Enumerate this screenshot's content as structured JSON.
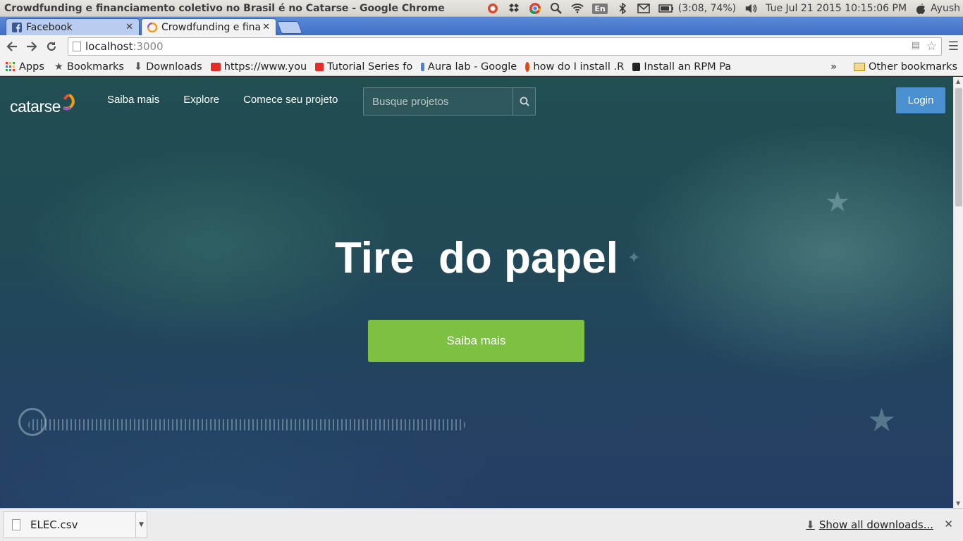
{
  "os": {
    "window_title": "Crowdfunding e financiamento coletivo no Brasil é no Catarse - Google Chrome",
    "keyboard": "En",
    "battery": "(3:08, 74%)",
    "clock": "Tue Jul 21 2015 10:15:06 PM",
    "user": "Ayush"
  },
  "tabs": [
    {
      "label": "Facebook"
    },
    {
      "label": "Crowdfunding e fina"
    }
  ],
  "toolbar": {
    "url_host": "localhost",
    "url_port": ":3000"
  },
  "bookmarks": {
    "items": [
      {
        "label": "Apps"
      },
      {
        "label": "Bookmarks"
      },
      {
        "label": "Downloads"
      },
      {
        "label": "https://www.you"
      },
      {
        "label": "Tutorial Series fo"
      },
      {
        "label": "Aura lab - Google"
      },
      {
        "label": "how do I install .R"
      },
      {
        "label": "Install an RPM Pa"
      }
    ],
    "overflow": "»",
    "other": "Other bookmarks"
  },
  "site": {
    "logo_text": "catarse",
    "nav": [
      "Saiba mais",
      "Explore",
      "Comece seu projeto"
    ],
    "search_placeholder": "Busque projetos",
    "login": "Login",
    "hero_title": "Tire  do papel",
    "cta": "Saiba mais"
  },
  "downloads": {
    "file": "ELEC.csv",
    "show_all": "Show all downloads..."
  },
  "colors": {
    "cta_green": "#7dc142",
    "login_blue": "#4a8fd0",
    "hero_bg": "#214e51"
  }
}
